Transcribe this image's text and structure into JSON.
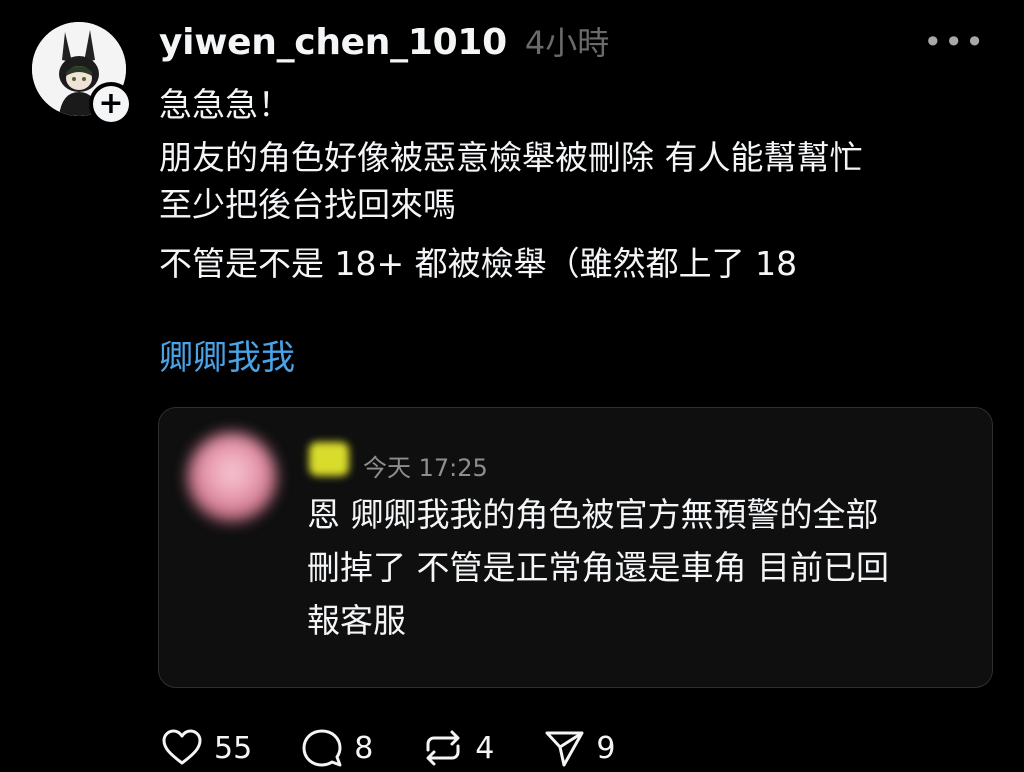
{
  "post": {
    "username": "yiwen_chen_1010",
    "timestamp": "4小時",
    "more_icon": "more-horizontal-icon",
    "follow_icon": "plus-icon",
    "body": [
      "急急急！",
      "朋友的角色好像被惡意檢舉被刪除 有人能幫幫忙",
      "至少把後台找回來嗎",
      "不管是不是 18+ 都被檢舉（雖然都上了 18"
    ],
    "tag": "卿卿我我"
  },
  "quote": {
    "timestamp": "今天 17:25",
    "text": [
      "恩 卿卿我我的角色被官方無預警的全部",
      "刪掉了 不管是正常角還是車角 目前已回",
      "報客服"
    ]
  },
  "actions": {
    "likes": "55",
    "replies": "8",
    "reposts": "4",
    "shares": "9"
  },
  "colors": {
    "background": "#000000",
    "text": "#f3f5f7",
    "muted": "#6a6a6a",
    "link": "#4aa3e6",
    "card": "#0f0f0f"
  }
}
